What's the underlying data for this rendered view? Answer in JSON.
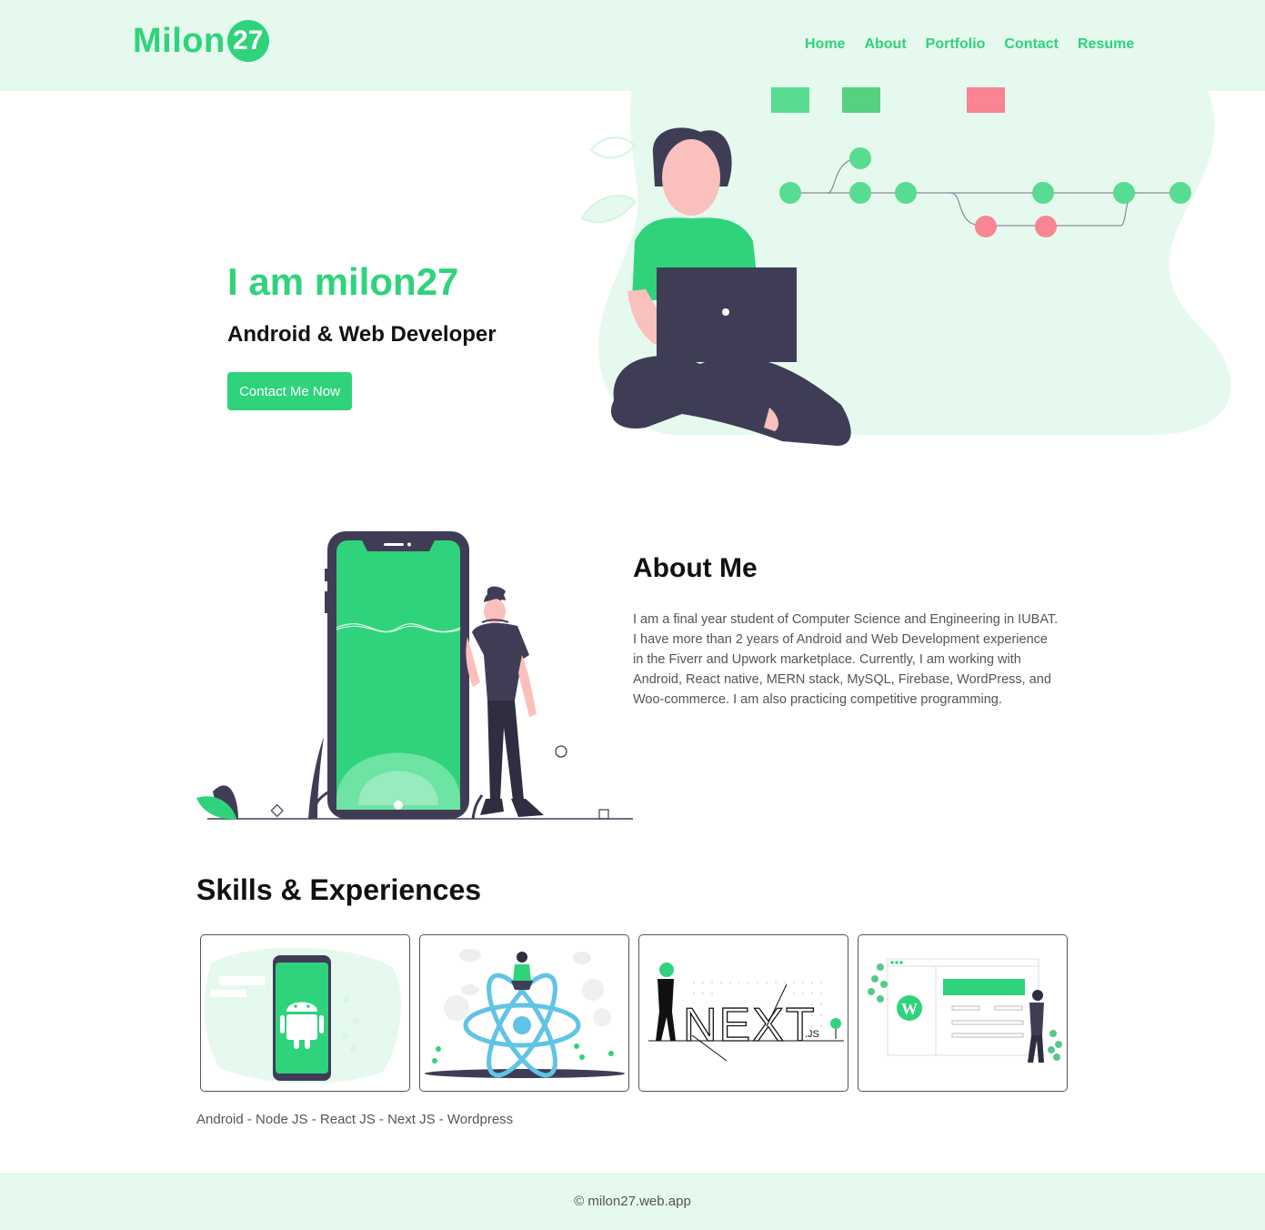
{
  "brand": {
    "name": "Milon",
    "badge": "27"
  },
  "nav": [
    {
      "label": "Home"
    },
    {
      "label": "About"
    },
    {
      "label": "Portfolio"
    },
    {
      "label": "Contact"
    },
    {
      "label": "Resume"
    }
  ],
  "hero": {
    "title": "I am milon27",
    "subtitle": "Android & Web Developer",
    "cta": "Contact Me Now"
  },
  "about": {
    "title": "About Me",
    "text": "I am a final year student of Computer Science and Engineering in IUBAT. I have more than 2 years of Android and Web Development experience in the Fiverr and Upwork marketplace. Currently, I am working with Android, React native, MERN stack, MySQL, Firebase, WordPress, and Woo-commerce. I am also practicing competitive programming."
  },
  "skills": {
    "title": "Skills & Experiences",
    "cards": [
      {
        "name": "Android"
      },
      {
        "name": "React JS"
      },
      {
        "name": "Next JS",
        "logo_text": "NEXT",
        "logo_suffix": ".JS"
      },
      {
        "name": "Wordpress"
      }
    ],
    "list": "Android - Node JS - React JS - Next JS - Wordpress"
  },
  "footer": {
    "text": "© milon27.web.app"
  },
  "colors": {
    "accent": "#2fd37b",
    "light": "#e6f9ee",
    "dark": "#3f3d56",
    "pink": "#f98493"
  }
}
